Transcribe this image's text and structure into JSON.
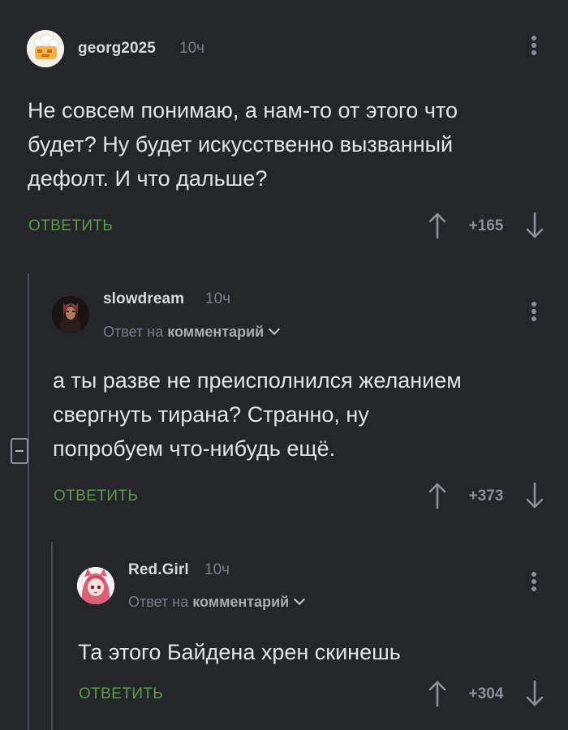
{
  "comments": [
    {
      "author": "georg2025",
      "time": "10ч",
      "avatar_icon": "sheep-avatar-icon",
      "text_lines": [
        "Не совсем понимаю, а нам-то от этого что",
        "будет? Ну будет искусственно вызванный",
        "дефолт. И что дальше?"
      ],
      "reply_label": "ОТВЕТИТЬ",
      "rating": "+165"
    },
    {
      "author": "slowdream",
      "time": "10ч",
      "avatar_icon": "dark-portrait-avatar-icon",
      "reply_prefix": "Ответ на",
      "reply_target": "комментарий",
      "text_lines": [
        "а ты разве не преисполнился желанием",
        "свергнуть тирана? Странно, ну",
        "попробуем что-нибудь ещё."
      ],
      "reply_label": "ОТВЕТИТЬ",
      "rating": "+373"
    },
    {
      "author": "Red.Girl",
      "time": "10ч",
      "avatar_icon": "anime-girl-avatar-icon",
      "reply_prefix": "Ответ на",
      "reply_target": "комментарий",
      "text_lines": [
        "Та этого Байдена хрен скинешь"
      ],
      "reply_label": "ОТВЕТИТЬ",
      "rating": "+304"
    }
  ],
  "colors": {
    "background": "#24262a",
    "reply_green": "#5d9a4b",
    "muted_text": "#7a7d82",
    "body_text": "#e2e3e5"
  }
}
